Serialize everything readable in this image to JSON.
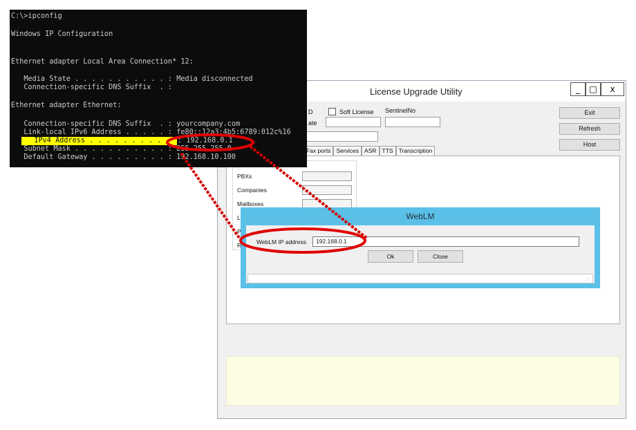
{
  "luu": {
    "title": "License Upgrade Utility",
    "minimize": "_",
    "maximize": "□",
    "close": "x",
    "fields": {
      "id_label": "D",
      "soft_license_label": "Soft License",
      "sentinel_label": "SentinelNo",
      "date_label": "ate"
    },
    "buttons": {
      "exit": "Exit",
      "refresh": "Refresh",
      "host": "Host"
    },
    "tabs": [
      "Fax ports",
      "Services",
      "ASR",
      "TTS",
      "Transcription"
    ],
    "group_rows": [
      "PBXs",
      "Companies",
      "Mailboxes",
      "La",
      "Pr",
      "Re"
    ]
  },
  "weblm": {
    "title": "WebLM",
    "ip_label": "WebLM IP address",
    "ip_value": "192.168.0.1",
    "ok": "Ok",
    "close": "Close"
  },
  "console": {
    "lines": [
      "C:\\>ipconfig",
      "",
      "Windows IP Configuration",
      "",
      "",
      "Ethernet adapter Local Area Connection* 12:",
      "",
      "   Media State . . . . . . . . . . . : Media disconnected",
      "   Connection-specific DNS Suffix  . :",
      "",
      "Ethernet adapter Ethernet:",
      "",
      "   Connection-specific DNS Suffix  . : yourcompany.com",
      "   Link-local IPv6 Address . . . . . : fe80::12a3:4b5:6789:012c%16",
      "   IPv4 Address . . . . . . . . . . . : 192.168.0.1",
      "   Subnet Mask . . . . . . . . . . . : 255.255.255.0",
      "   Default Gateway . . . . . . . . . : 192.168.10.100"
    ],
    "highlight_line": 14,
    "highlight_text": "   IPv4 Address . . . . . . . . . . "
  },
  "colors": {
    "callout": "#e00000",
    "highlight": "#ffff00",
    "weblm_frame": "#5bc0e8"
  }
}
